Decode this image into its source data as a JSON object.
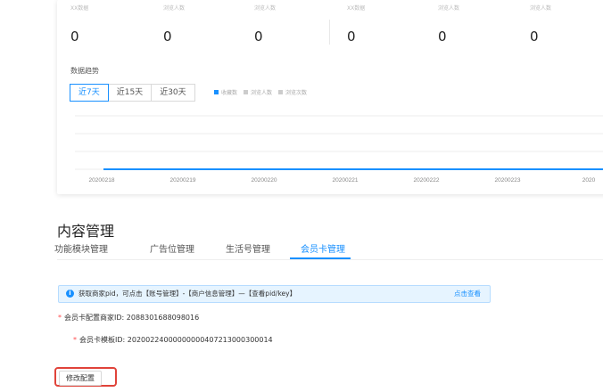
{
  "stats": {
    "labels": [
      "XX数据",
      "浏览人数",
      "浏览人数",
      "XX数据",
      "浏览人数",
      "浏览人数"
    ],
    "values": [
      "0",
      "0",
      "0",
      "0",
      "0",
      "0"
    ]
  },
  "trend": {
    "title": "数据趋势",
    "ranges": [
      "近7天",
      "近15天",
      "近30天"
    ],
    "active_range": "近7天",
    "legend": [
      "收藏数",
      "浏览人数",
      "浏览次数"
    ]
  },
  "chart_data": {
    "type": "line",
    "x": [
      "20200218",
      "20200219",
      "20200220",
      "20200221",
      "20200222",
      "20200223",
      "2020"
    ],
    "series": [
      {
        "name": "收藏数",
        "values": [
          0,
          0,
          0,
          0,
          0,
          0,
          0
        ],
        "color": "#1890ff"
      },
      {
        "name": "浏览人数",
        "values": [
          0,
          0,
          0,
          0,
          0,
          0,
          0
        ],
        "color": "#cccccc"
      },
      {
        "name": "浏览次数",
        "values": [
          0,
          0,
          0,
          0,
          0,
          0,
          0
        ],
        "color": "#cccccc"
      }
    ],
    "grid": true
  },
  "content": {
    "title": "内容管理",
    "tabs": [
      "功能模块管理",
      "广告位管理",
      "生活号管理",
      "会员卡管理"
    ],
    "active_tab": "会员卡管理"
  },
  "alert": {
    "text": "获取商家pid，可点击【账号管理】-【商户信息管理】—【查看pid/key】",
    "link": "点击查看"
  },
  "fields": {
    "merchant_id_label": "会员卡配置商家ID:",
    "merchant_id_value": "2088301688098016",
    "template_id_label": "会员卡模板ID:",
    "template_id_value": "20200224000000000407213000300014"
  },
  "actions": {
    "edit_label": "修改配置"
  },
  "colors": {
    "accent": "#1890ff",
    "highlight": "#e0433a"
  }
}
